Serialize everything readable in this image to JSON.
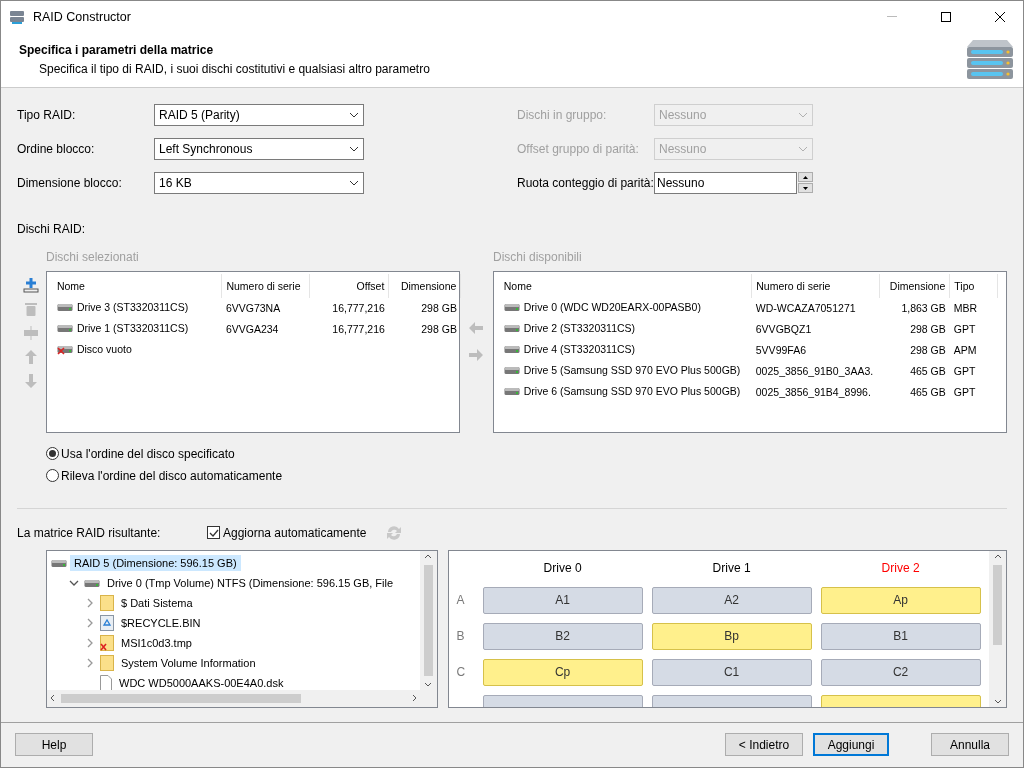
{
  "window": {
    "title": "RAID Constructor"
  },
  "header": {
    "title": "Specifica i parametri della matrice",
    "subtitle": "Specifica il tipo di RAID, i suoi dischi costitutivi e qualsiasi altro parametro"
  },
  "params": [
    {
      "label": "Tipo RAID:",
      "value": "RAID 5 (Parity)",
      "kind": "dropdown",
      "disabled": false
    },
    {
      "label": "Dischi in gruppo:",
      "value": "Nessuno",
      "kind": "dropdown",
      "disabled": true
    },
    {
      "label": "Ordine blocco:",
      "value": "Left Synchronous",
      "kind": "dropdown",
      "disabled": false
    },
    {
      "label": "Offset gruppo di parità:",
      "value": "Nessuno",
      "kind": "dropdown",
      "disabled": true
    },
    {
      "label": "Dimensione blocco:",
      "value": "16 KB",
      "kind": "dropdown",
      "disabled": false
    },
    {
      "label": "Ruota conteggio di parità:",
      "value": "Nessuno",
      "kind": "spinner",
      "disabled": false
    }
  ],
  "disks_label": "Dischi RAID:",
  "toolbar": [
    {
      "kind": "add",
      "disabled": false
    },
    {
      "kind": "delete",
      "disabled": true
    },
    {
      "kind": "insert",
      "disabled": true
    },
    {
      "kind": "up",
      "disabled": true
    },
    {
      "kind": "down",
      "disabled": true
    }
  ],
  "selected_disks": {
    "caption": "Dischi selezionati",
    "columns": [
      "Nome",
      "Numero di serie",
      "Offset",
      "Dimensione"
    ],
    "rows": [
      {
        "kind": "drive",
        "cells": [
          "Drive 3 (ST3320311CS)",
          "6VVG73NA",
          "16,777,216",
          "298 GB"
        ]
      },
      {
        "kind": "drive",
        "cells": [
          "Drive 1 (ST3320311CS)",
          "6VVGA234",
          "16,777,216",
          "298 GB"
        ]
      },
      {
        "kind": "empty",
        "cells": [
          "Disco vuoto"
        ]
      }
    ]
  },
  "transfer": [
    {
      "kind": "left",
      "disabled": true
    },
    {
      "kind": "right",
      "disabled": true
    }
  ],
  "available_disks": {
    "caption": "Dischi disponibili",
    "columns": [
      "Nome",
      "Numero di serie",
      "Dimensione",
      "Tipo"
    ],
    "rows": [
      {
        "kind": "drive",
        "cells": [
          "Drive 0 (WDC WD20EARX-00PASB0)",
          "WD-WCAZA7051271",
          "1,863 GB",
          "MBR"
        ]
      },
      {
        "kind": "drive",
        "cells": [
          "Drive 2 (ST3320311CS)",
          "6VVGBQZ1",
          "298 GB",
          "GPT"
        ]
      },
      {
        "kind": "drive",
        "cells": [
          "Drive 4 (ST3320311CS)",
          "5VV99FA6",
          "298 GB",
          "APM"
        ]
      },
      {
        "kind": "drive",
        "cells": [
          "Drive 5 (Samsung SSD 970 EVO Plus 500GB)",
          "0025_3856_91B0_3AA3.",
          "465 GB",
          "GPT"
        ]
      },
      {
        "kind": "drive",
        "cells": [
          "Drive 6 (Samsung SSD 970 EVO Plus 500GB)",
          "0025_3856_91B4_8996.",
          "465 GB",
          "GPT"
        ]
      }
    ]
  },
  "order_options": [
    {
      "label": "Usa l'ordine del disco specificato",
      "selected": true
    },
    {
      "label": "Rileva l'ordine del disco automaticamente",
      "selected": false
    }
  ],
  "result": {
    "label": "La matrice RAID risultante:",
    "auto_update": {
      "label": "Aggiorna automaticamente",
      "checked": true
    },
    "tree": [
      {
        "label": "RAID 5 (Dimensione: 596.15 GB)",
        "kind": "drive",
        "selected": true,
        "children": [
          {
            "label": "Drive 0 (Tmp Volume) NTFS (Dimensione: 596.15 GB, File",
            "kind": "drive",
            "selected": false,
            "expanded": true,
            "children": [
              {
                "label": "$ Dati Sistema",
                "kind": "folder",
                "selected": false,
                "expanded": false
              },
              {
                "label": "$RECYCLE.BIN",
                "kind": "recycle",
                "selected": false,
                "expanded": false
              },
              {
                "label": "MSI1c0d3.tmp",
                "kind": "deleted-folder",
                "selected": false,
                "expanded": false
              },
              {
                "label": "System Volume Information",
                "kind": "folder",
                "selected": false,
                "expanded": false
              },
              {
                "label": "WDC WD5000AAKS-00E4A0.dsk",
                "kind": "file",
                "selected": false
              }
            ]
          }
        ]
      }
    ],
    "layout": {
      "columns": [
        {
          "label": "Drive 0",
          "color": "#000000"
        },
        {
          "label": "Drive 1",
          "color": "#000000"
        },
        {
          "label": "Drive 2",
          "color": "#ff0000"
        }
      ],
      "rows": [
        {
          "label": "A",
          "blocks": [
            {
              "text": "A1",
              "kind": "data"
            },
            {
              "text": "A2",
              "kind": "data"
            },
            {
              "text": "Ap",
              "kind": "parity"
            }
          ]
        },
        {
          "label": "B",
          "blocks": [
            {
              "text": "B2",
              "kind": "data"
            },
            {
              "text": "Bp",
              "kind": "parity"
            },
            {
              "text": "B1",
              "kind": "data"
            }
          ]
        },
        {
          "label": "C",
          "blocks": [
            {
              "text": "Cp",
              "kind": "parity"
            },
            {
              "text": "C1",
              "kind": "data"
            },
            {
              "text": "C2",
              "kind": "data"
            }
          ]
        },
        {
          "blocks": [
            {
              "kind": "data"
            },
            {
              "kind": "data"
            },
            {
              "kind": "parity"
            }
          ]
        }
      ]
    }
  },
  "buttons": [
    {
      "label": "Help",
      "kind": "help",
      "default": false
    },
    {
      "label": "< Indietro",
      "kind": "nav",
      "default": false
    },
    {
      "label": "Aggiungi",
      "kind": "nav",
      "default": true
    },
    {
      "label": "Annulla",
      "kind": "cancel",
      "default": false
    }
  ]
}
